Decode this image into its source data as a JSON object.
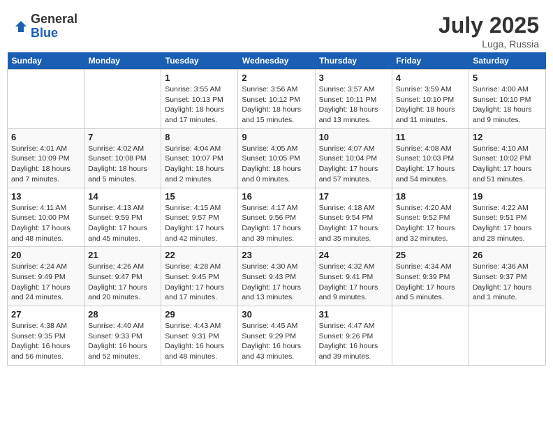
{
  "header": {
    "logo_general": "General",
    "logo_blue": "Blue",
    "month": "July 2025",
    "location": "Luga, Russia"
  },
  "weekdays": [
    "Sunday",
    "Monday",
    "Tuesday",
    "Wednesday",
    "Thursday",
    "Friday",
    "Saturday"
  ],
  "weeks": [
    [
      {
        "day": "",
        "info": ""
      },
      {
        "day": "",
        "info": ""
      },
      {
        "day": "1",
        "info": "Sunrise: 3:55 AM\nSunset: 10:13 PM\nDaylight: 18 hours\nand 17 minutes."
      },
      {
        "day": "2",
        "info": "Sunrise: 3:56 AM\nSunset: 10:12 PM\nDaylight: 18 hours\nand 15 minutes."
      },
      {
        "day": "3",
        "info": "Sunrise: 3:57 AM\nSunset: 10:11 PM\nDaylight: 18 hours\nand 13 minutes."
      },
      {
        "day": "4",
        "info": "Sunrise: 3:59 AM\nSunset: 10:10 PM\nDaylight: 18 hours\nand 11 minutes."
      },
      {
        "day": "5",
        "info": "Sunrise: 4:00 AM\nSunset: 10:10 PM\nDaylight: 18 hours\nand 9 minutes."
      }
    ],
    [
      {
        "day": "6",
        "info": "Sunrise: 4:01 AM\nSunset: 10:09 PM\nDaylight: 18 hours\nand 7 minutes."
      },
      {
        "day": "7",
        "info": "Sunrise: 4:02 AM\nSunset: 10:08 PM\nDaylight: 18 hours\nand 5 minutes."
      },
      {
        "day": "8",
        "info": "Sunrise: 4:04 AM\nSunset: 10:07 PM\nDaylight: 18 hours\nand 2 minutes."
      },
      {
        "day": "9",
        "info": "Sunrise: 4:05 AM\nSunset: 10:05 PM\nDaylight: 18 hours\nand 0 minutes."
      },
      {
        "day": "10",
        "info": "Sunrise: 4:07 AM\nSunset: 10:04 PM\nDaylight: 17 hours\nand 57 minutes."
      },
      {
        "day": "11",
        "info": "Sunrise: 4:08 AM\nSunset: 10:03 PM\nDaylight: 17 hours\nand 54 minutes."
      },
      {
        "day": "12",
        "info": "Sunrise: 4:10 AM\nSunset: 10:02 PM\nDaylight: 17 hours\nand 51 minutes."
      }
    ],
    [
      {
        "day": "13",
        "info": "Sunrise: 4:11 AM\nSunset: 10:00 PM\nDaylight: 17 hours\nand 48 minutes."
      },
      {
        "day": "14",
        "info": "Sunrise: 4:13 AM\nSunset: 9:59 PM\nDaylight: 17 hours\nand 45 minutes."
      },
      {
        "day": "15",
        "info": "Sunrise: 4:15 AM\nSunset: 9:57 PM\nDaylight: 17 hours\nand 42 minutes."
      },
      {
        "day": "16",
        "info": "Sunrise: 4:17 AM\nSunset: 9:56 PM\nDaylight: 17 hours\nand 39 minutes."
      },
      {
        "day": "17",
        "info": "Sunrise: 4:18 AM\nSunset: 9:54 PM\nDaylight: 17 hours\nand 35 minutes."
      },
      {
        "day": "18",
        "info": "Sunrise: 4:20 AM\nSunset: 9:52 PM\nDaylight: 17 hours\nand 32 minutes."
      },
      {
        "day": "19",
        "info": "Sunrise: 4:22 AM\nSunset: 9:51 PM\nDaylight: 17 hours\nand 28 minutes."
      }
    ],
    [
      {
        "day": "20",
        "info": "Sunrise: 4:24 AM\nSunset: 9:49 PM\nDaylight: 17 hours\nand 24 minutes."
      },
      {
        "day": "21",
        "info": "Sunrise: 4:26 AM\nSunset: 9:47 PM\nDaylight: 17 hours\nand 20 minutes."
      },
      {
        "day": "22",
        "info": "Sunrise: 4:28 AM\nSunset: 9:45 PM\nDaylight: 17 hours\nand 17 minutes."
      },
      {
        "day": "23",
        "info": "Sunrise: 4:30 AM\nSunset: 9:43 PM\nDaylight: 17 hours\nand 13 minutes."
      },
      {
        "day": "24",
        "info": "Sunrise: 4:32 AM\nSunset: 9:41 PM\nDaylight: 17 hours\nand 9 minutes."
      },
      {
        "day": "25",
        "info": "Sunrise: 4:34 AM\nSunset: 9:39 PM\nDaylight: 17 hours\nand 5 minutes."
      },
      {
        "day": "26",
        "info": "Sunrise: 4:36 AM\nSunset: 9:37 PM\nDaylight: 17 hours\nand 1 minute."
      }
    ],
    [
      {
        "day": "27",
        "info": "Sunrise: 4:38 AM\nSunset: 9:35 PM\nDaylight: 16 hours\nand 56 minutes."
      },
      {
        "day": "28",
        "info": "Sunrise: 4:40 AM\nSunset: 9:33 PM\nDaylight: 16 hours\nand 52 minutes."
      },
      {
        "day": "29",
        "info": "Sunrise: 4:43 AM\nSunset: 9:31 PM\nDaylight: 16 hours\nand 48 minutes."
      },
      {
        "day": "30",
        "info": "Sunrise: 4:45 AM\nSunset: 9:29 PM\nDaylight: 16 hours\nand 43 minutes."
      },
      {
        "day": "31",
        "info": "Sunrise: 4:47 AM\nSunset: 9:26 PM\nDaylight: 16 hours\nand 39 minutes."
      },
      {
        "day": "",
        "info": ""
      },
      {
        "day": "",
        "info": ""
      }
    ]
  ]
}
